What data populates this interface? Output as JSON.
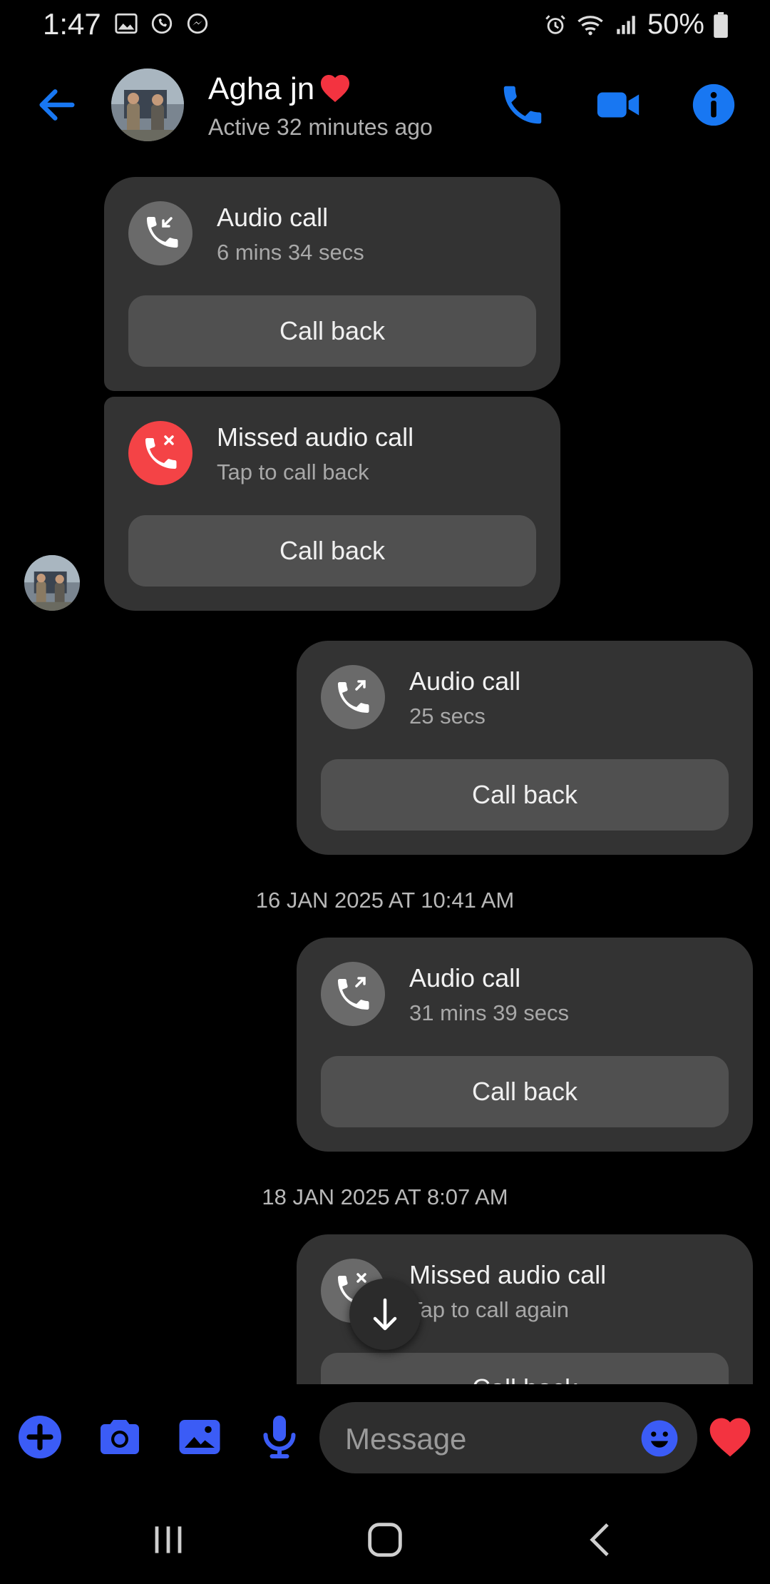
{
  "status_bar": {
    "time": "1:47",
    "battery": "50%",
    "icons": [
      "gallery-icon",
      "whatsapp-icon",
      "messenger-icon",
      "alarm-icon",
      "wifi-icon",
      "signal-icon",
      "battery-icon"
    ]
  },
  "header": {
    "name": "Agha jn",
    "status": "Active 32 minutes ago",
    "accent": "#1877f2"
  },
  "messages": [
    {
      "direction": "incoming",
      "type": "call",
      "icon": "incoming-call-icon",
      "title": "Audio call",
      "subtitle": "6 mins 34 secs",
      "button": "Call back"
    },
    {
      "direction": "incoming",
      "type": "missed",
      "icon": "missed-call-icon",
      "title": "Missed audio call",
      "subtitle": "Tap to call back",
      "button": "Call back"
    },
    {
      "direction": "outgoing",
      "type": "call",
      "icon": "outgoing-call-icon",
      "title": "Audio call",
      "subtitle": "25 secs",
      "button": "Call back"
    },
    {
      "type": "timestamp",
      "text": "16 JAN 2025 AT 10:41 AM"
    },
    {
      "direction": "outgoing",
      "type": "call",
      "icon": "outgoing-call-icon",
      "title": "Audio call",
      "subtitle": "31 mins 39 secs",
      "button": "Call back"
    },
    {
      "type": "timestamp",
      "text": "18 JAN 2025 AT 8:07 AM"
    },
    {
      "direction": "outgoing",
      "type": "missed",
      "icon": "missed-call-icon",
      "title": "Missed audio call",
      "subtitle": "Tap to call again",
      "button": "Call back"
    }
  ],
  "composer": {
    "placeholder": "Message"
  },
  "colors": {
    "background": "#000000",
    "card": "#333333",
    "button": "#505050",
    "missed": "#f44346",
    "composer_icons": "#3b5cf6"
  }
}
